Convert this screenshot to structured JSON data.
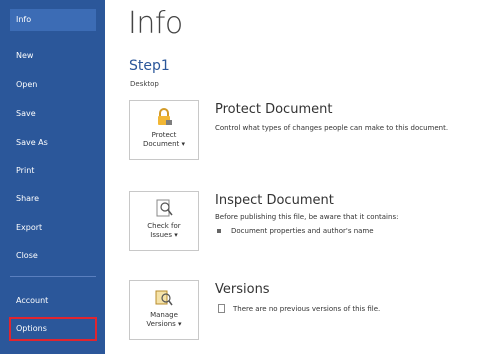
{
  "sidebar": {
    "items": [
      {
        "label": "Info"
      },
      {
        "label": "New"
      },
      {
        "label": "Open"
      },
      {
        "label": "Save"
      },
      {
        "label": "Save As"
      },
      {
        "label": "Print"
      },
      {
        "label": "Share"
      },
      {
        "label": "Export"
      },
      {
        "label": "Close"
      },
      {
        "label": "Account"
      },
      {
        "label": "Options"
      }
    ]
  },
  "main": {
    "title": "Info",
    "document_name": "Step1",
    "document_path": "Desktop",
    "protect": {
      "button_label": "Protect\nDocument ▾",
      "title": "Protect Document",
      "description": "Control what types of changes people can make to this document."
    },
    "inspect": {
      "button_label": "Check for\nIssues ▾",
      "title": "Inspect Document",
      "description": "Before publishing this file, be aware that it contains:",
      "bullet": "Document properties and author's name"
    },
    "versions": {
      "button_label": "Manage\nVersions ▾",
      "title": "Versions",
      "description": "There are no previous versions of this file."
    }
  },
  "colors": {
    "sidebar_bg": "#2b579a",
    "accent": "#2b579a",
    "highlight_border": "#e0252f"
  },
  "icons": {
    "protect": "lock-icon",
    "inspect": "inspect-document-icon",
    "versions": "manage-versions-icon",
    "versions_note": "document-icon"
  }
}
